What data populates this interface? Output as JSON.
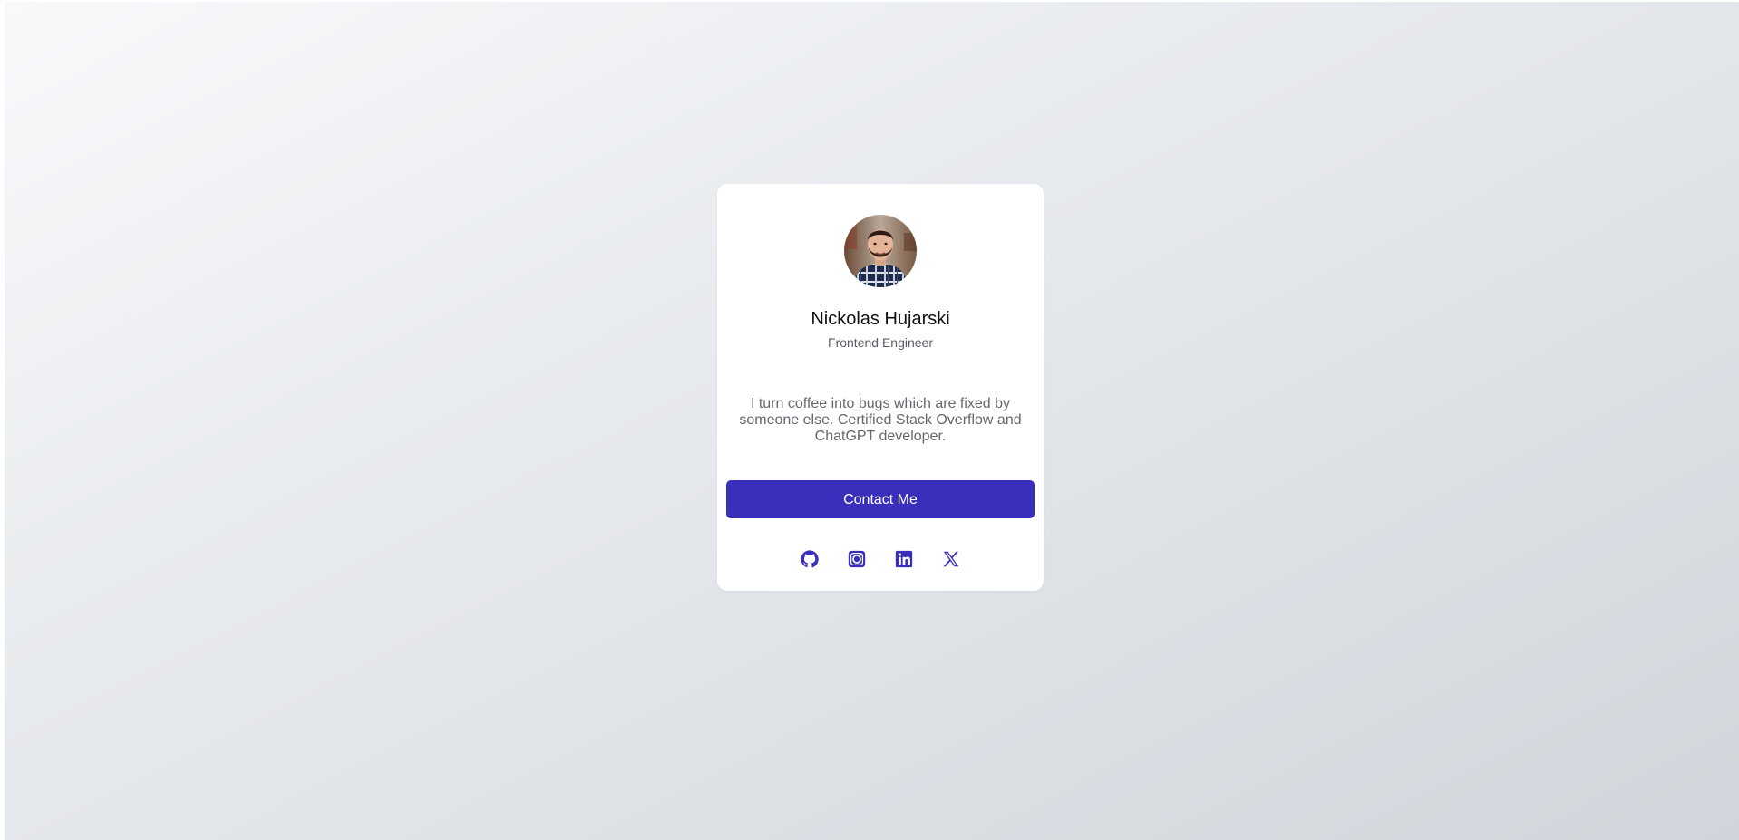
{
  "theme": {
    "accent": "#3a2fbd",
    "card_background": "#ffffff",
    "page_gradient": [
      "#f8f9fb",
      "#d1d5db"
    ]
  },
  "profile": {
    "avatar_alt": "profile-photo",
    "name": "Nickolas Hujarski",
    "role": "Frontend Engineer",
    "bio": "I turn coffee into bugs which are fixed by someone else. Certified Stack Overflow and ChatGPT developer."
  },
  "actions": {
    "contact_label": "Contact Me"
  },
  "socials": [
    {
      "icon": "github-icon"
    },
    {
      "icon": "instagram-icon"
    },
    {
      "icon": "linkedin-icon"
    },
    {
      "icon": "x-twitter-icon"
    }
  ]
}
